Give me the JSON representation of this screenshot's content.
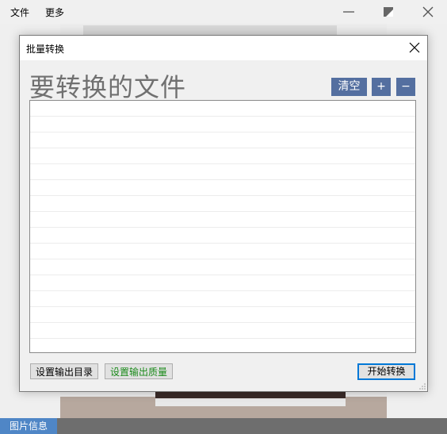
{
  "menubar": {
    "items": [
      {
        "label": "文件"
      },
      {
        "label": "更多"
      }
    ]
  },
  "window_controls": {
    "minimize_icon": "minimize-icon",
    "restore_icon": "restore-icon",
    "close_icon": "close-icon"
  },
  "dialog": {
    "title": "批量转换",
    "heading": "要转换的文件",
    "clear_label": "清空",
    "add_label": "+",
    "remove_label": "−",
    "set_output_dir_label": "设置输出目录",
    "set_output_quality_label": "设置输出质量",
    "start_label": "开始转换",
    "file_list": []
  },
  "statusbar": {
    "tab_label": "图片信息"
  },
  "colors": {
    "accent_blue": "#546fa0",
    "status_tab": "#4f86c6",
    "primary_border": "#0078d7",
    "quality_text": "#1a8a1a"
  }
}
